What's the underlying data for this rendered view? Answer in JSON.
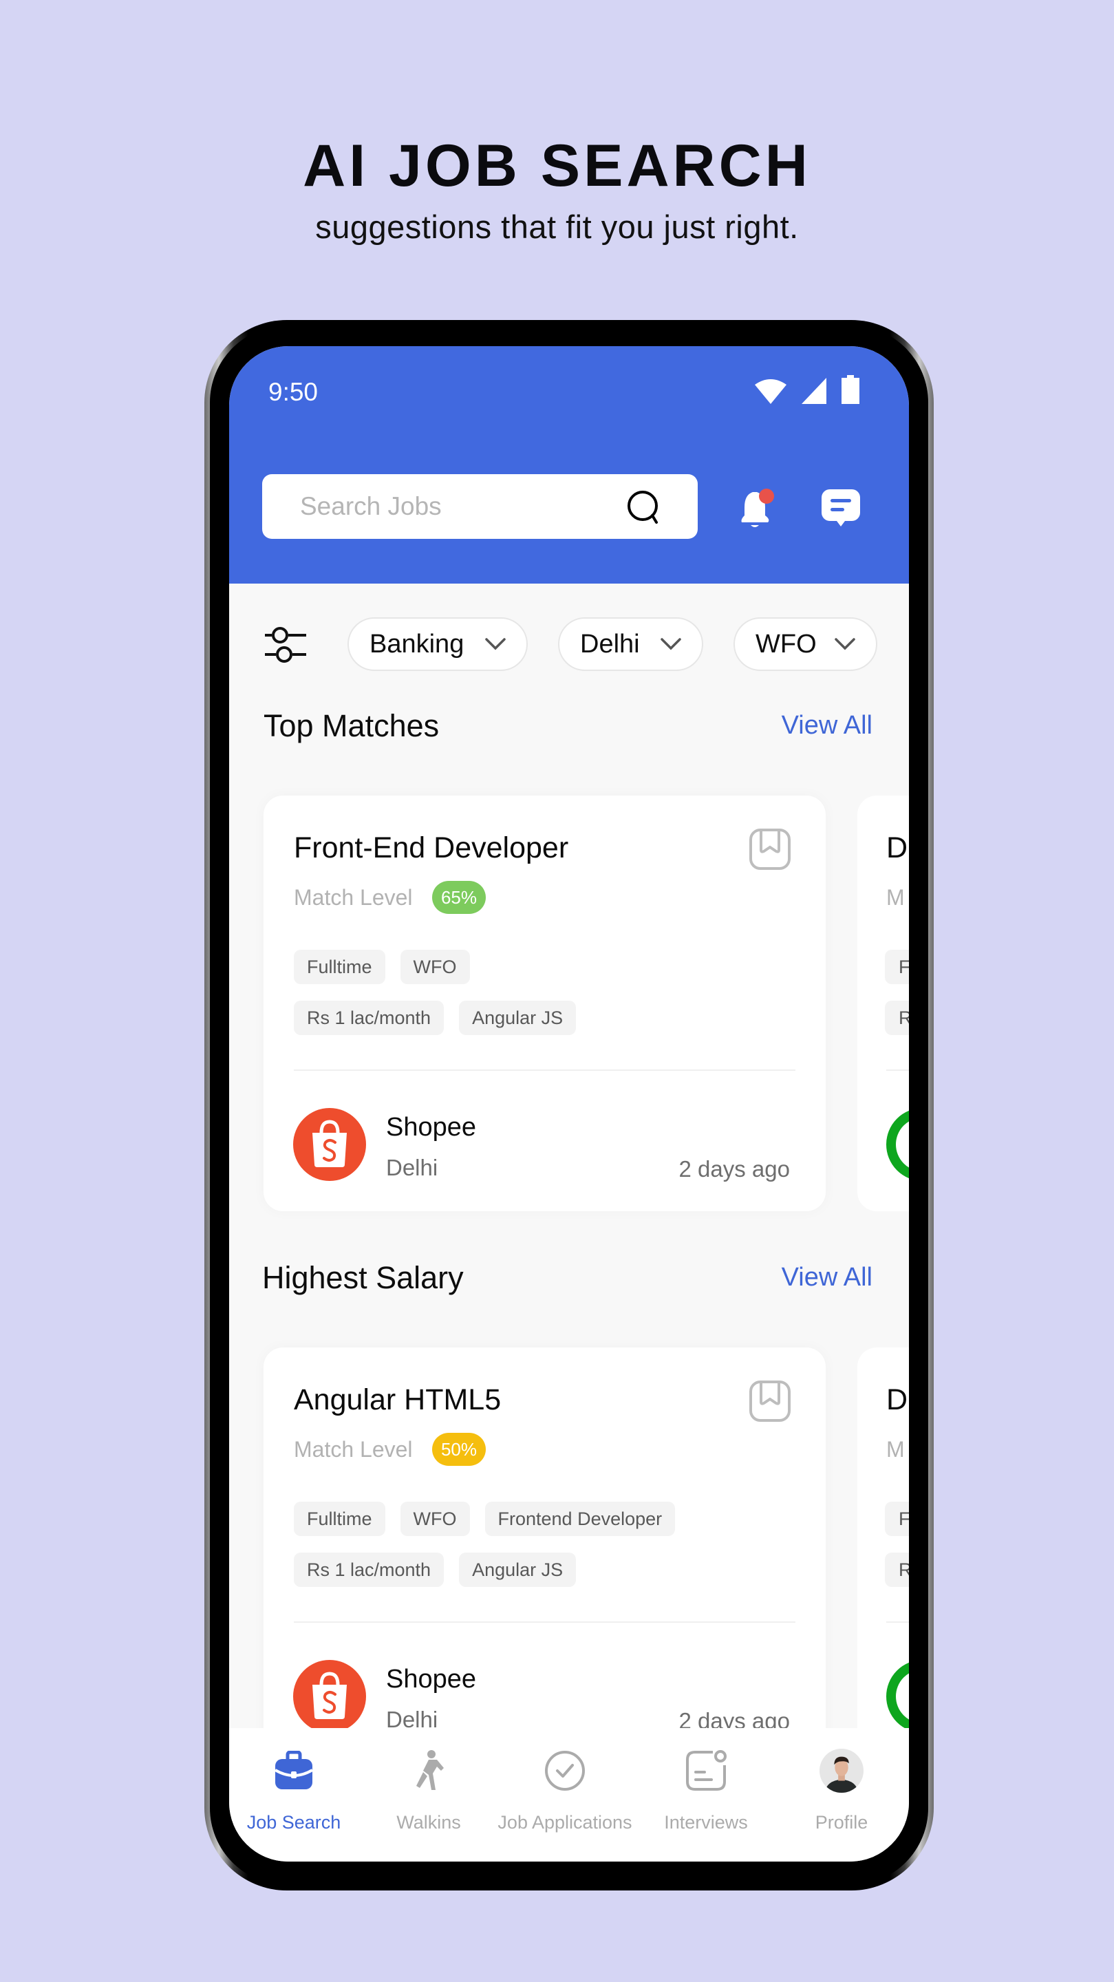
{
  "promo": {
    "title": "AI JOB SEARCH",
    "subtitle": "suggestions that fit you just right."
  },
  "status_bar": {
    "time": "9:50",
    "icons": [
      "wifi-icon",
      "signal-icon",
      "battery-icon"
    ]
  },
  "header": {
    "search": {
      "placeholder": "Search Jobs",
      "value": ""
    },
    "notification_badge": true,
    "colors": {
      "primary": "#4169DF",
      "badge": "#E8524A"
    }
  },
  "filters": {
    "chips": [
      {
        "label": "Banking"
      },
      {
        "label": "Delhi"
      },
      {
        "label": "WFO"
      }
    ]
  },
  "sections": [
    {
      "title": "Top Matches",
      "view_all": "View All",
      "card": {
        "title": "Front-End Developer",
        "match_label": "Match Level",
        "match_value": "65%",
        "match_color": "#7DCB5D",
        "tags": [
          [
            "Fulltime",
            "WFO"
          ],
          [
            "Rs 1 lac/month",
            "Angular JS"
          ]
        ],
        "company": "Shopee",
        "location": "Delhi",
        "posted": "2 days ago"
      },
      "peek_card": {
        "title_fragment": "D",
        "match_fragment": "M",
        "tag_fragments": [
          "F",
          "R"
        ]
      }
    },
    {
      "title": "Highest Salary",
      "view_all": "View All",
      "card": {
        "title": "Angular HTML5",
        "match_label": "Match Level",
        "match_value": "50%",
        "match_color": "#F5BE0E",
        "tags": [
          [
            "Fulltime",
            "WFO",
            "Frontend Developer"
          ],
          [
            "Rs 1 lac/month",
            "Angular JS"
          ]
        ],
        "company": "Shopee",
        "location": "Delhi",
        "posted": "2 days ago"
      },
      "peek_card": {
        "title_fragment": "D",
        "match_fragment": "M",
        "tag_fragments": [
          "F",
          "R"
        ]
      }
    }
  ],
  "bottom_nav": {
    "items": [
      {
        "label": "Job Search",
        "icon": "briefcase-icon",
        "active": true
      },
      {
        "label": "Walkins",
        "icon": "walking-person-icon",
        "active": false
      },
      {
        "label": "Job Applications",
        "icon": "check-circle-icon",
        "active": false
      },
      {
        "label": "Interviews",
        "icon": "interview-note-icon",
        "active": false
      },
      {
        "label": "Profile",
        "icon": "avatar-icon",
        "active": false
      }
    ]
  }
}
